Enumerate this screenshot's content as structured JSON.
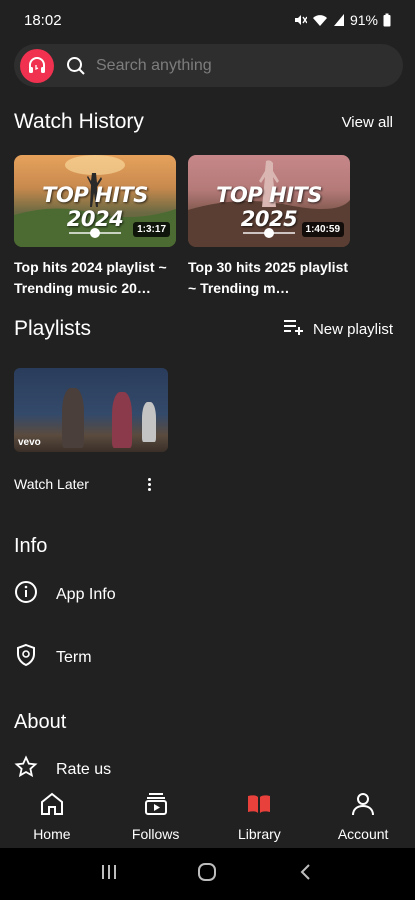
{
  "status_bar": {
    "time": "18:02",
    "battery": "91%"
  },
  "search": {
    "placeholder": "Search anything"
  },
  "watch_history": {
    "title": "Watch History",
    "view_all": "View all",
    "items": [
      {
        "thumb_text": "TOP HITS 2024",
        "duration": "1:3:17",
        "title": "Top hits 2024 playlist ~ Trending music 20…"
      },
      {
        "thumb_text": "TOP HITS 2025",
        "duration": "1:40:59",
        "title": "Top 30 hits 2025 playlist ~ Trending m…"
      }
    ]
  },
  "playlists": {
    "title": "Playlists",
    "new_playlist": "New playlist",
    "items": [
      {
        "name": "Watch Later",
        "badge": "vevo"
      }
    ]
  },
  "info": {
    "title": "Info",
    "items": [
      {
        "label": "App Info",
        "icon": "info-icon"
      },
      {
        "label": "Term",
        "icon": "shield-icon"
      }
    ]
  },
  "about": {
    "title": "About",
    "items": [
      {
        "label": "Rate us",
        "icon": "star-icon"
      }
    ]
  },
  "bottom_nav": [
    {
      "label": "Home",
      "icon": "home-icon"
    },
    {
      "label": "Follows",
      "icon": "follows-icon"
    },
    {
      "label": "Library",
      "icon": "library-icon",
      "active": true
    },
    {
      "label": "Account",
      "icon": "account-icon"
    }
  ],
  "colors": {
    "background": "#212121",
    "accent": "#f0314f",
    "library_active": "#e8413c"
  }
}
